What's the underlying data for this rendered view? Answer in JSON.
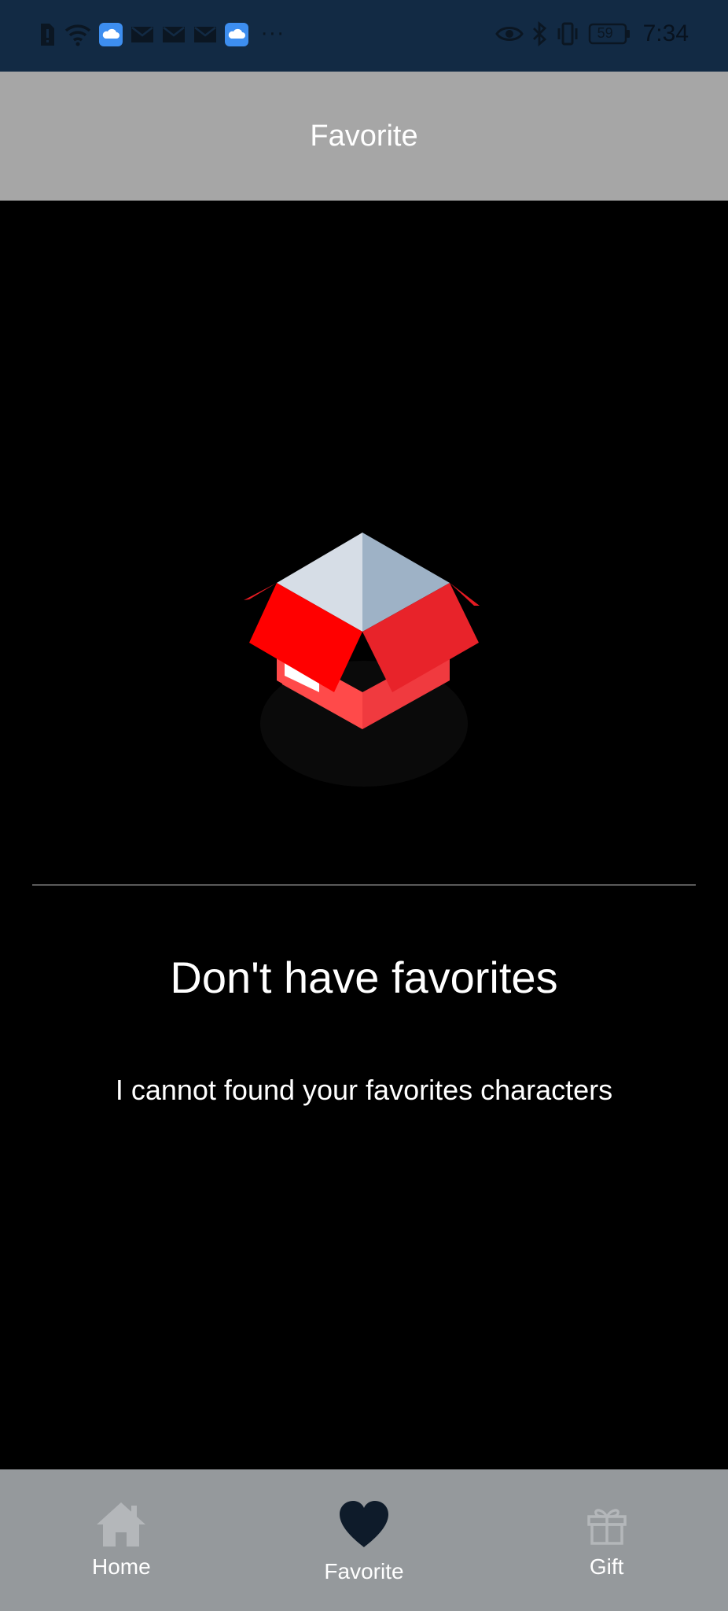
{
  "status_bar": {
    "time": "7:34",
    "battery": "59",
    "more": "···"
  },
  "header": {
    "title": "Favorite"
  },
  "empty_state": {
    "title": "Don't have favorites",
    "subtitle": "I cannot found your favorites characters",
    "illustration": "open-box-icon"
  },
  "bottom_nav": {
    "items": [
      {
        "label": "Home",
        "icon": "home-icon",
        "active": false
      },
      {
        "label": "Favorite",
        "icon": "heart-icon",
        "active": true
      },
      {
        "label": "Gift",
        "icon": "gift-icon",
        "active": false
      }
    ]
  },
  "colors": {
    "status_bar_bg": "#122a44",
    "header_bg": "#a6a6a6",
    "nav_bg": "#95999c",
    "active_icon": "#0e1b2a",
    "inactive_icon": "#b4b7ba",
    "box_red": "#e5222a",
    "box_light_red": "#ff4444"
  }
}
